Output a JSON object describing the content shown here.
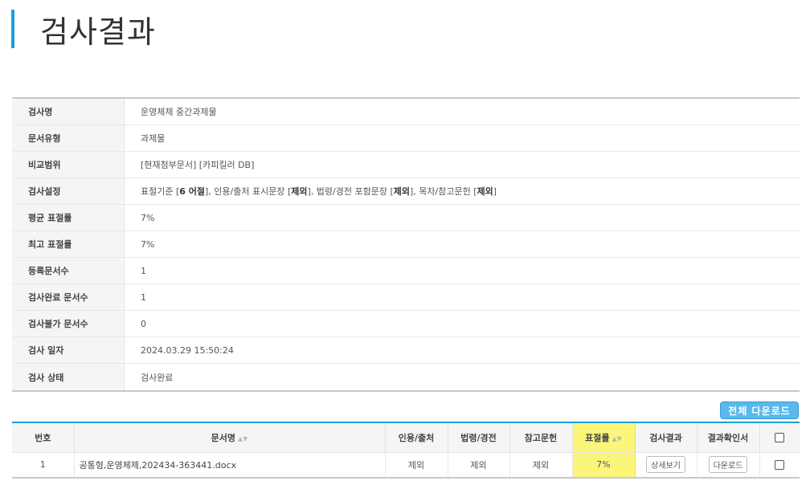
{
  "page": {
    "title": "검사결과"
  },
  "info": {
    "rows": [
      {
        "label": "검사명",
        "value": "운영체제 중간과제물"
      },
      {
        "label": "문서유형",
        "value": "과제물"
      },
      {
        "label": "비교범위",
        "value": "[현재첨부문서] [카피킬러 DB]"
      },
      {
        "label": "검사설정",
        "value": ""
      },
      {
        "label": "평균 표절률",
        "value": "7%"
      },
      {
        "label": "최고 표절률",
        "value": "7%"
      },
      {
        "label": "등록문서수",
        "value": "1"
      },
      {
        "label": "검사완료 문서수",
        "value": "1"
      },
      {
        "label": "검사불가 문서수",
        "value": "0"
      },
      {
        "label": "검사 일자",
        "value": "2024.03.29 15:50:24"
      },
      {
        "label": "검사 상태",
        "value": "검사완료"
      }
    ],
    "settings_parts": {
      "p1": "표절기준 [",
      "b1": "6 어절",
      "p2": "], 인용/출처 표시문장 [",
      "b2": "제외",
      "p3": "], 법령/경전 포함문장 [",
      "b3": "제외",
      "p4": "], 목차/참고문헌 [",
      "b4": "제외",
      "p5": "]"
    }
  },
  "download_all_label": "전체 다운로드",
  "result_table": {
    "headers": {
      "no": "번호",
      "doc_name": "문서명",
      "quote": "인용/출처",
      "law": "법령/경전",
      "reference": "참고문헌",
      "rate": "표절률",
      "result": "검사결과",
      "certificate": "결과확인서"
    },
    "sort_icon": "sort-arrows-icon",
    "rows": [
      {
        "no": "1",
        "doc_name": "공통형,운영체제,202434-363441.docx",
        "quote": "제외",
        "law": "제외",
        "reference": "제외",
        "rate": "7%",
        "result_button": "상세보기",
        "certificate_button": "다운로드"
      }
    ]
  },
  "colors": {
    "accent": "#1a9fd8",
    "button": "#5bb8ec",
    "highlight": "#fbf67a"
  }
}
